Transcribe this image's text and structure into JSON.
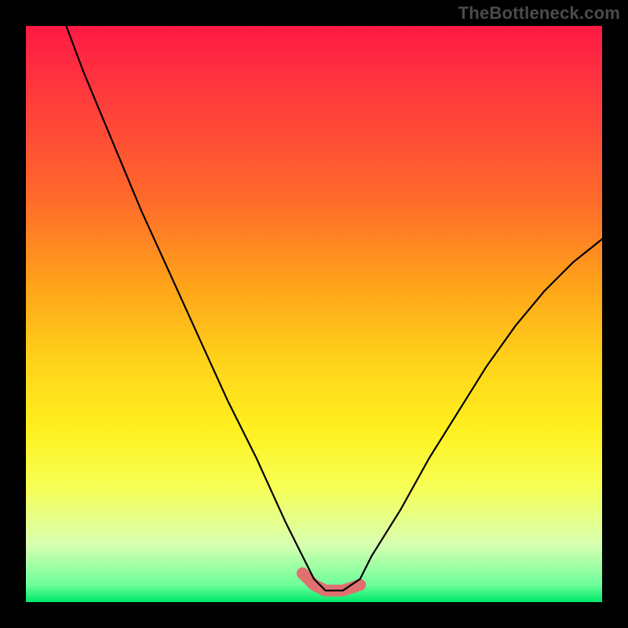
{
  "watermark": {
    "text": "TheBottleneck.com"
  },
  "chart_data": {
    "type": "line",
    "title": "",
    "xlabel": "",
    "ylabel": "",
    "xlim": [
      0,
      100
    ],
    "ylim": [
      0,
      100
    ],
    "grid": false,
    "series": [
      {
        "name": "curve",
        "x": [
          7,
          10,
          15,
          20,
          25,
          30,
          35,
          40,
          45,
          48,
          50,
          52,
          55,
          58,
          60,
          65,
          70,
          75,
          80,
          85,
          90,
          95,
          100
        ],
        "values": [
          100,
          92,
          80,
          68,
          57,
          46,
          35,
          25,
          14,
          8,
          4,
          2,
          2,
          4,
          8,
          16,
          25,
          33,
          41,
          48,
          54,
          59,
          63
        ]
      }
    ],
    "highlight_band": {
      "x": [
        48,
        50,
        52,
        55,
        58
      ],
      "values": [
        5,
        3,
        2,
        2,
        3
      ]
    },
    "background_gradient": {
      "stops": [
        {
          "pos": 0,
          "color": "#ff1a44"
        },
        {
          "pos": 30,
          "color": "#ff6a2a"
        },
        {
          "pos": 58,
          "color": "#ffd21a"
        },
        {
          "pos": 80,
          "color": "#f7ff55"
        },
        {
          "pos": 97,
          "color": "#6cff9a"
        },
        {
          "pos": 100,
          "color": "#00e86b"
        }
      ]
    }
  }
}
